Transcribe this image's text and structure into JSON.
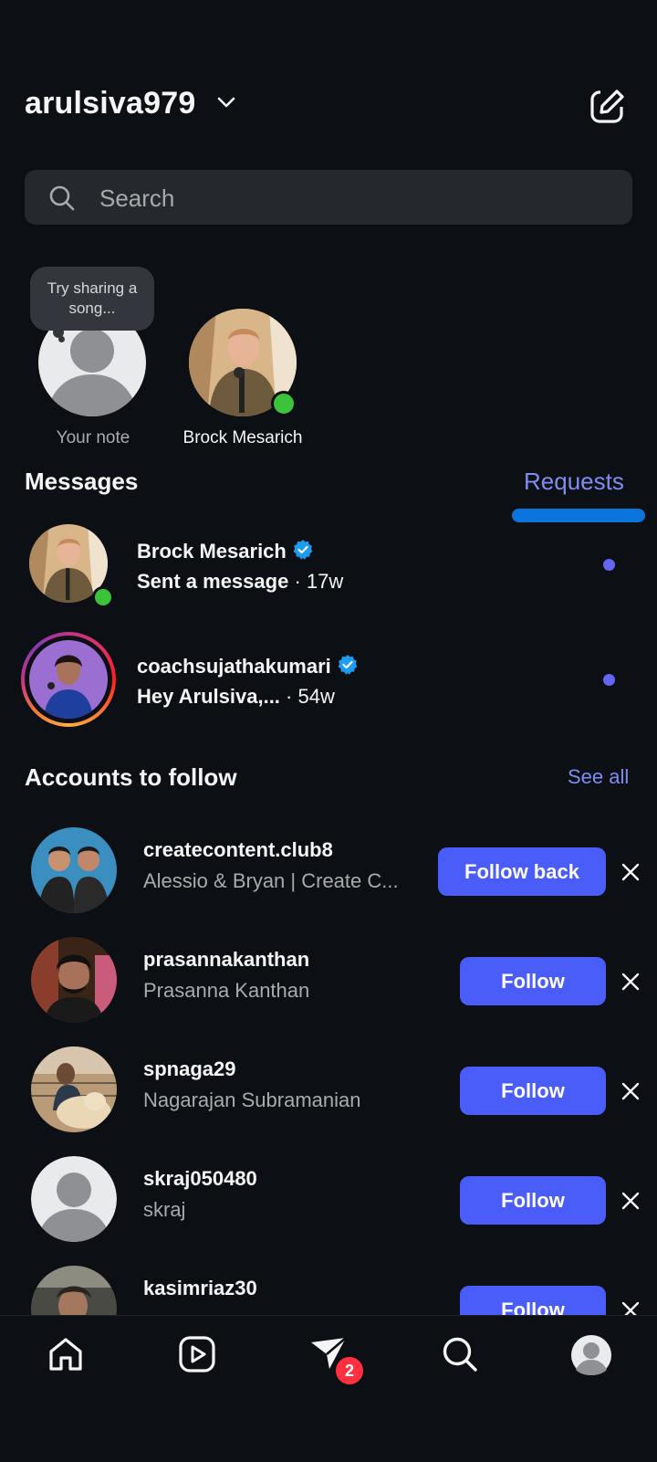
{
  "header": {
    "username": "arulsiva979"
  },
  "search": {
    "placeholder": "Search"
  },
  "notes": {
    "self_bubble": "Try sharing a song...",
    "self_label": "Your note",
    "items": [
      {
        "label": "Brock Mesarich",
        "online": true
      }
    ]
  },
  "messages": {
    "title": "Messages",
    "requests_label": "Requests",
    "threads": [
      {
        "name": "Brock Mesarich",
        "verified": true,
        "preview": "Sent a message",
        "time": "· 17w",
        "unread": true,
        "online": true
      },
      {
        "name": "coachsujathakumari",
        "verified": true,
        "preview": "Hey Arulsiva,...",
        "time": "· 54w",
        "unread": true,
        "story_ring": true
      }
    ]
  },
  "accounts_to_follow": {
    "title": "Accounts to follow",
    "see_all": "See all",
    "items": [
      {
        "username": "createcontent.club8",
        "full_name": "Alessio & Bryan | Create C...",
        "button": "Follow back"
      },
      {
        "username": "prasannakanthan",
        "full_name": "Prasanna Kanthan",
        "button": "Follow"
      },
      {
        "username": "spnaga29",
        "full_name": "Nagarajan Subramanian",
        "button": "Follow"
      },
      {
        "username": "skraj050480",
        "full_name": "skraj",
        "button": "Follow"
      },
      {
        "username": "kasimriaz30",
        "full_name": "",
        "button": "Follow"
      }
    ]
  },
  "bottom_nav": {
    "items": [
      "home-icon",
      "reels-icon",
      "direct-icon",
      "search-icon",
      "profile-icon"
    ],
    "direct_badge": "2"
  },
  "colors": {
    "background": "#0c1014",
    "accent": "#4a5df9",
    "link": "#7f8cf0",
    "online": "#3bc43b",
    "badge": "#ff3040"
  }
}
